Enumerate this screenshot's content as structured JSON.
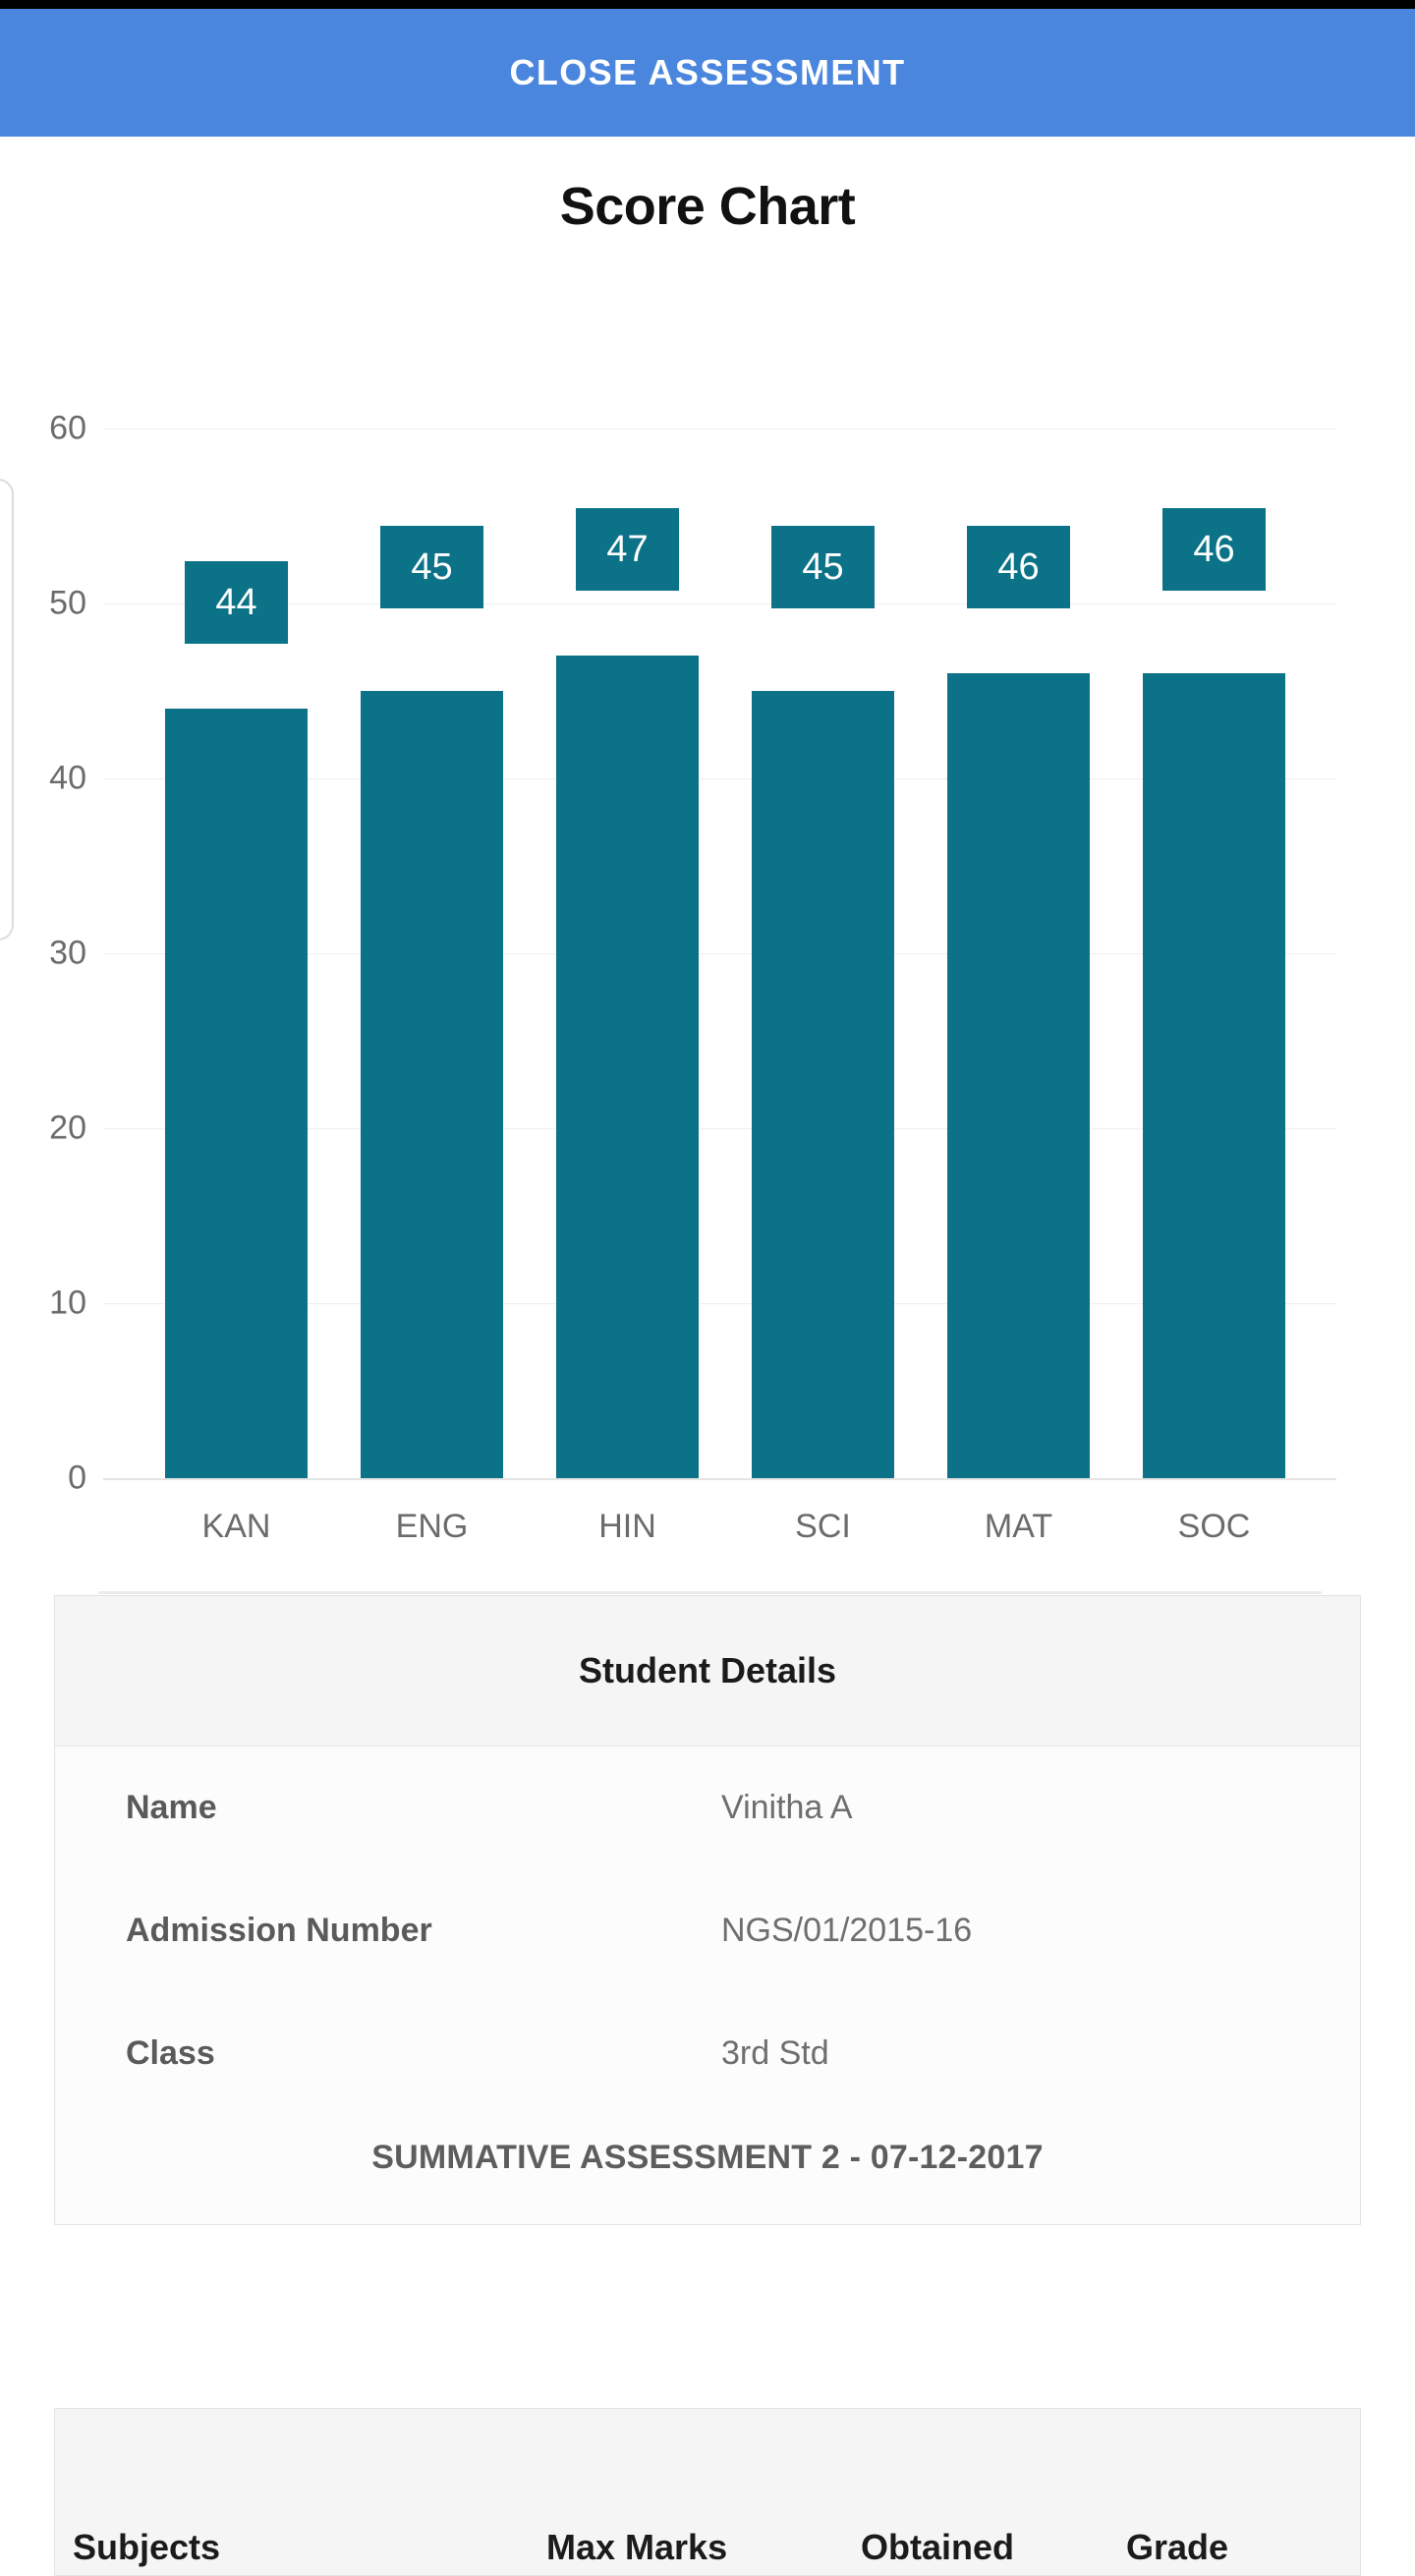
{
  "appbar": {
    "title": "CLOSE ASSESSMENT",
    "background": "#4a86dd",
    "text_color": "#ffffff"
  },
  "chart_data": {
    "type": "bar",
    "title": "Score Chart",
    "categories": [
      "KAN",
      "ENG",
      "HIN",
      "SCI",
      "MAT",
      "SOC"
    ],
    "values": [
      44,
      45,
      47,
      45,
      46,
      46
    ],
    "data_labels": [
      "44",
      "45",
      "47",
      "45",
      "46",
      "46"
    ],
    "xlabel": "",
    "ylabel": "",
    "ylim": [
      0,
      60
    ],
    "yticks": [
      60,
      50,
      40,
      30,
      20,
      10,
      0
    ],
    "ytick_labels": [
      "60",
      "50",
      "40",
      "30",
      "20",
      "10",
      "0"
    ],
    "grid": true,
    "legend": false,
    "bar_color": "#0b7287",
    "label_chip_color": "#0b7287",
    "label_text_color": "#ffffff",
    "axis_text_color": "#6b6b6b"
  },
  "student_details": {
    "header": "Student Details",
    "rows": [
      {
        "label": "Name",
        "value": "Vinitha A"
      },
      {
        "label": "Admission Number",
        "value": "NGS/01/2015-16"
      },
      {
        "label": "Class",
        "value": "3rd Std"
      }
    ],
    "assessment": "SUMMATIVE ASSESSMENT 2 - 07-12-2017"
  },
  "marks_table": {
    "columns": [
      "Subjects",
      "Max Marks",
      "Obtained",
      "Grade"
    ]
  }
}
